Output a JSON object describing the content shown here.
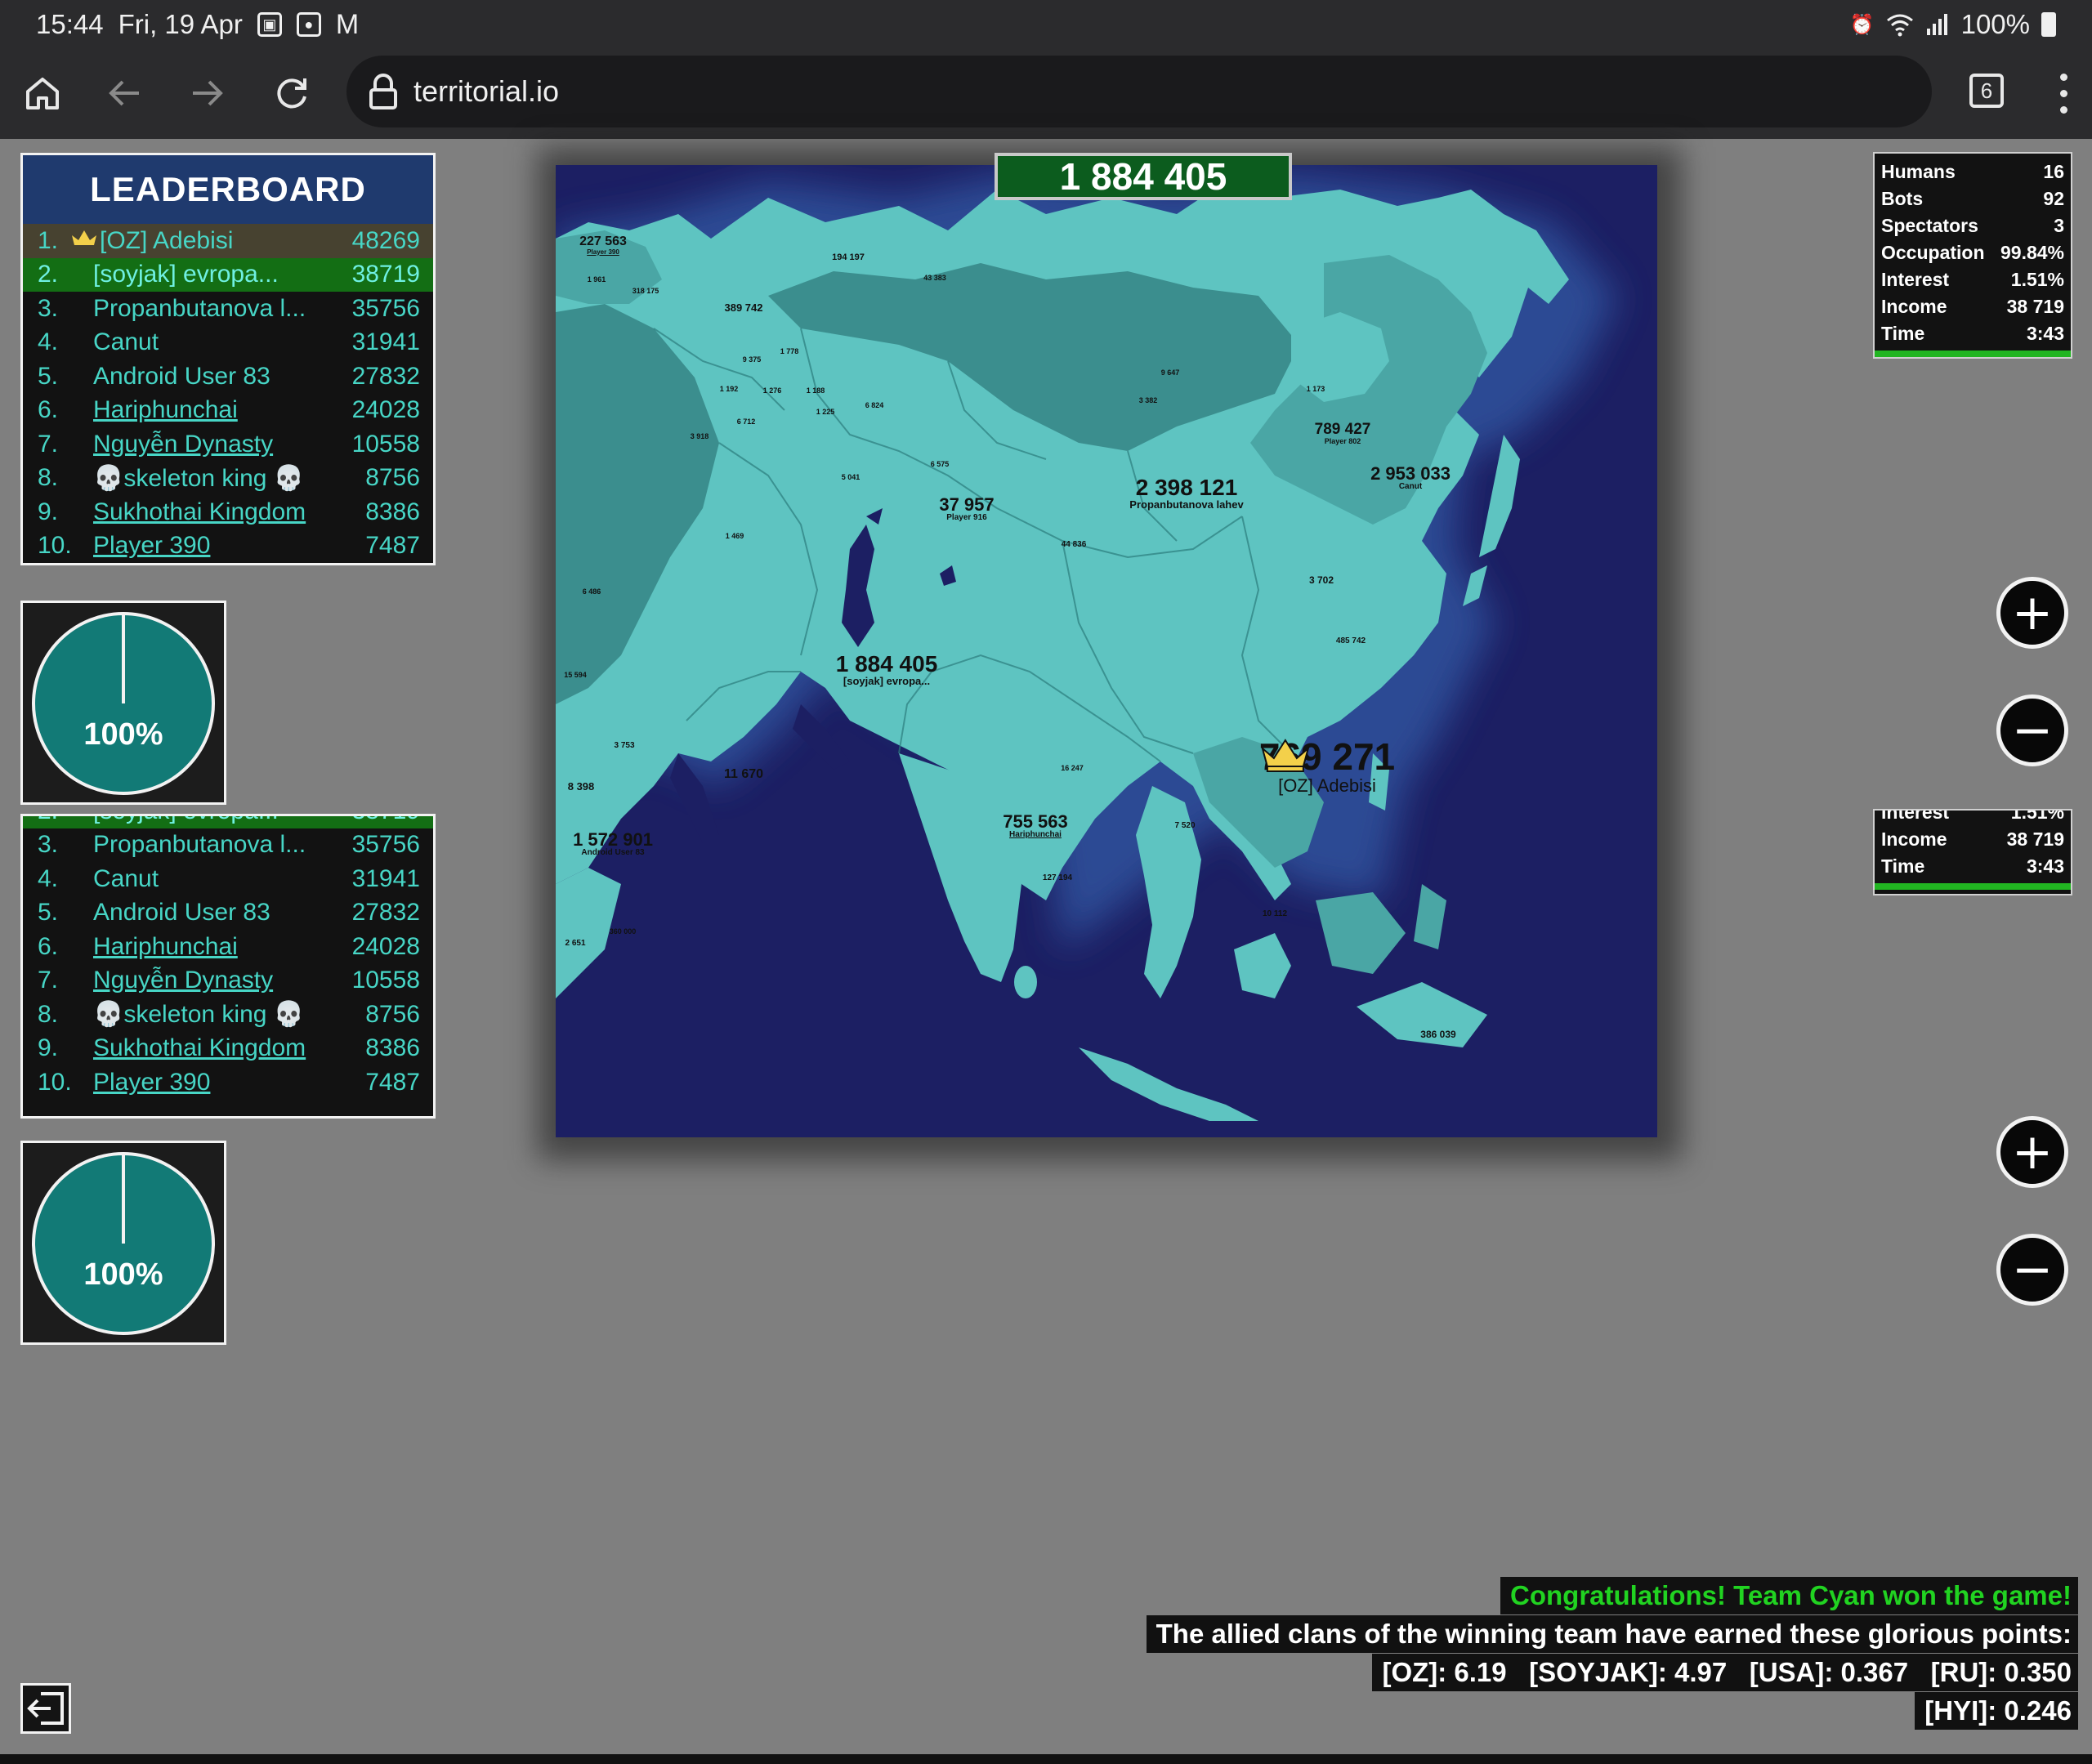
{
  "status_bar": {
    "time": "15:44",
    "date": "Fri, 19 Apr",
    "battery": "100%",
    "icons": [
      "gallery-icon",
      "camera-icon",
      "gmail-icon",
      "alarm-icon",
      "wifi-icon",
      "signal-icon",
      "battery-icon"
    ]
  },
  "browser": {
    "url": "territorial.io",
    "tab_count": "6",
    "icons": [
      "home-icon",
      "back-icon",
      "forward-icon",
      "reload-icon",
      "lock-icon",
      "tabs-icon",
      "menu-icon"
    ]
  },
  "leaderboard": {
    "title": "LEADERBOARD",
    "rows": [
      {
        "rank": "1.",
        "name": "[OZ] Adebisi",
        "score": "48269",
        "crown": true
      },
      {
        "rank": "2.",
        "name": "[soyjak] evropa...",
        "score": "38719"
      },
      {
        "rank": "3.",
        "name": "Propanbutanova l...",
        "score": "35756"
      },
      {
        "rank": "4.",
        "name": "Canut",
        "score": "31941"
      },
      {
        "rank": "5.",
        "name": "Android User 83",
        "score": "27832"
      },
      {
        "rank": "6.",
        "name": "Hariphunchai",
        "score": "24028",
        "link": true
      },
      {
        "rank": "7.",
        "name": "Nguyễn Dynasty",
        "score": "10558",
        "link": true
      },
      {
        "rank": "8.",
        "name": "💀skeleton king 💀",
        "score": "8756"
      },
      {
        "rank": "9.",
        "name": "Sukhothai Kingdom",
        "score": "8386",
        "link": true
      },
      {
        "rank": "10.",
        "name": "Player 390",
        "score": "7487",
        "link": true
      }
    ]
  },
  "pie": {
    "label": "100%",
    "fraction": 1.0,
    "color": "#127a76"
  },
  "top_counter": "1 884 405",
  "stats": {
    "rows": [
      {
        "label": "Humans",
        "value": "16"
      },
      {
        "label": "Bots",
        "value": "92"
      },
      {
        "label": "Spectators",
        "value": "3"
      },
      {
        "label": "Occupation",
        "value": "99.84%"
      },
      {
        "label": "Interest",
        "value": "1.51%"
      },
      {
        "label": "Income",
        "value": "38 719"
      },
      {
        "label": "Time",
        "value": "3:43"
      }
    ]
  },
  "map": {
    "colors": {
      "ocean": "#1c1f63",
      "land_light": "#5ec4c1",
      "land_mid": "#4aa6a5",
      "land_dark": "#3b8e8e"
    },
    "labels": [
      {
        "value": "227 563",
        "owner": "Player 390"
      },
      {
        "value": "194 197",
        "owner": ""
      },
      {
        "value": "43 383",
        "owner": ""
      },
      {
        "value": "389 742",
        "owner": ""
      },
      {
        "value": "1 961",
        "owner": ""
      },
      {
        "value": "318 175",
        "owner": ""
      },
      {
        "value": "1 778",
        "owner": ""
      },
      {
        "value": "9 375",
        "owner": ""
      },
      {
        "value": "1 192",
        "owner": ""
      },
      {
        "value": "1 276",
        "owner": ""
      },
      {
        "value": "1 188",
        "owner": ""
      },
      {
        "value": "6 824",
        "owner": ""
      },
      {
        "value": "6 712",
        "owner": ""
      },
      {
        "value": "1 225",
        "owner": ""
      },
      {
        "value": "9 647",
        "owner": ""
      },
      {
        "value": "1 173",
        "owner": ""
      },
      {
        "value": "3 382",
        "owner": ""
      },
      {
        "value": "3 918",
        "owner": ""
      },
      {
        "value": "789 427",
        "owner": "Player 802"
      },
      {
        "value": "6 575",
        "owner": ""
      },
      {
        "value": "5 041",
        "owner": ""
      },
      {
        "value": "37 957",
        "owner": "Player 916"
      },
      {
        "value": "2 398 121",
        "owner": "Propanbutanova lahev"
      },
      {
        "value": "2 953 033",
        "owner": "Canut"
      },
      {
        "value": "1 469",
        "owner": ""
      },
      {
        "value": "44 836",
        "owner": ""
      },
      {
        "value": "3 702",
        "owner": ""
      },
      {
        "value": "6 486",
        "owner": ""
      },
      {
        "value": "485 742",
        "owner": ""
      },
      {
        "value": "15 594",
        "owner": ""
      },
      {
        "value": "1 884 405",
        "owner": "[soyjak] evropa..."
      },
      {
        "value": "3 753",
        "owner": ""
      },
      {
        "value": "8 398",
        "owner": ""
      },
      {
        "value": "11 670",
        "owner": ""
      },
      {
        "value": "16 247",
        "owner": ""
      },
      {
        "value": "769 271",
        "owner": "[OZ] Adebisi"
      },
      {
        "value": "1 572 901",
        "owner": "Android User 83"
      },
      {
        "value": "755 563",
        "owner": "Hariphunchai"
      },
      {
        "value": "7 520",
        "owner": ""
      },
      {
        "value": "127 194",
        "owner": ""
      },
      {
        "value": "10 112",
        "owner": ""
      },
      {
        "value": "360 000",
        "owner": ""
      },
      {
        "value": "2 651",
        "owner": ""
      },
      {
        "value": "386 039",
        "owner": ""
      }
    ]
  },
  "messages": {
    "congrats": "Congratulations! Team Cyan won the game!",
    "points_intro": "The allied clans of the winning team have earned these glorious points:",
    "points_line1": "[OZ]: 6.19   [SOYJAK]: 4.97   [USA]: 0.367   [RU]: 0.350",
    "points_line2": "[HYI]: 0.246"
  },
  "zoom": {
    "plus": "+",
    "minus": "−"
  }
}
